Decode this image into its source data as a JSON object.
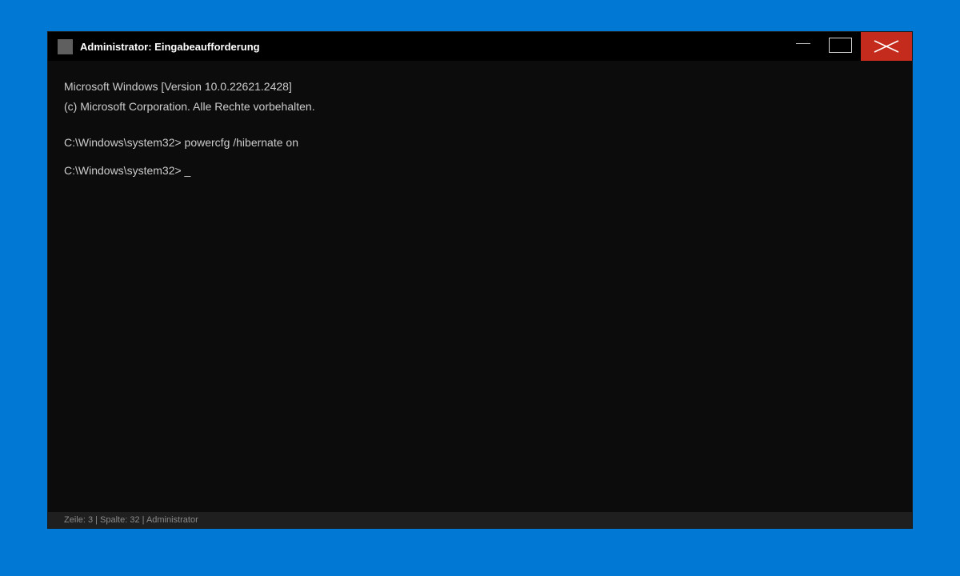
{
  "window": {
    "title": "Administrator: Eingabeaufforderung",
    "icon": "cmd-app-icon",
    "controls": {
      "minimize_icon": "minimize-icon",
      "maximize_icon": "maximize-icon",
      "close_icon": "close-icon",
      "close_color": "#c42b1c"
    }
  },
  "console": {
    "lines": [
      "Microsoft Windows [Version 10.0.22621.2428]",
      "(c) Microsoft Corporation. Alle Rechte vorbehalten.",
      "C:\\Windows\\system32> powercfg /hibernate on",
      "C:\\Windows\\system32> _"
    ]
  },
  "statusbar": {
    "text": "Zeile: 3 | Spalte: 32 | Administrator"
  },
  "colors": {
    "desktop": "#0078d4",
    "console_bg": "#0c0c0c",
    "console_text": "#cccccc"
  }
}
